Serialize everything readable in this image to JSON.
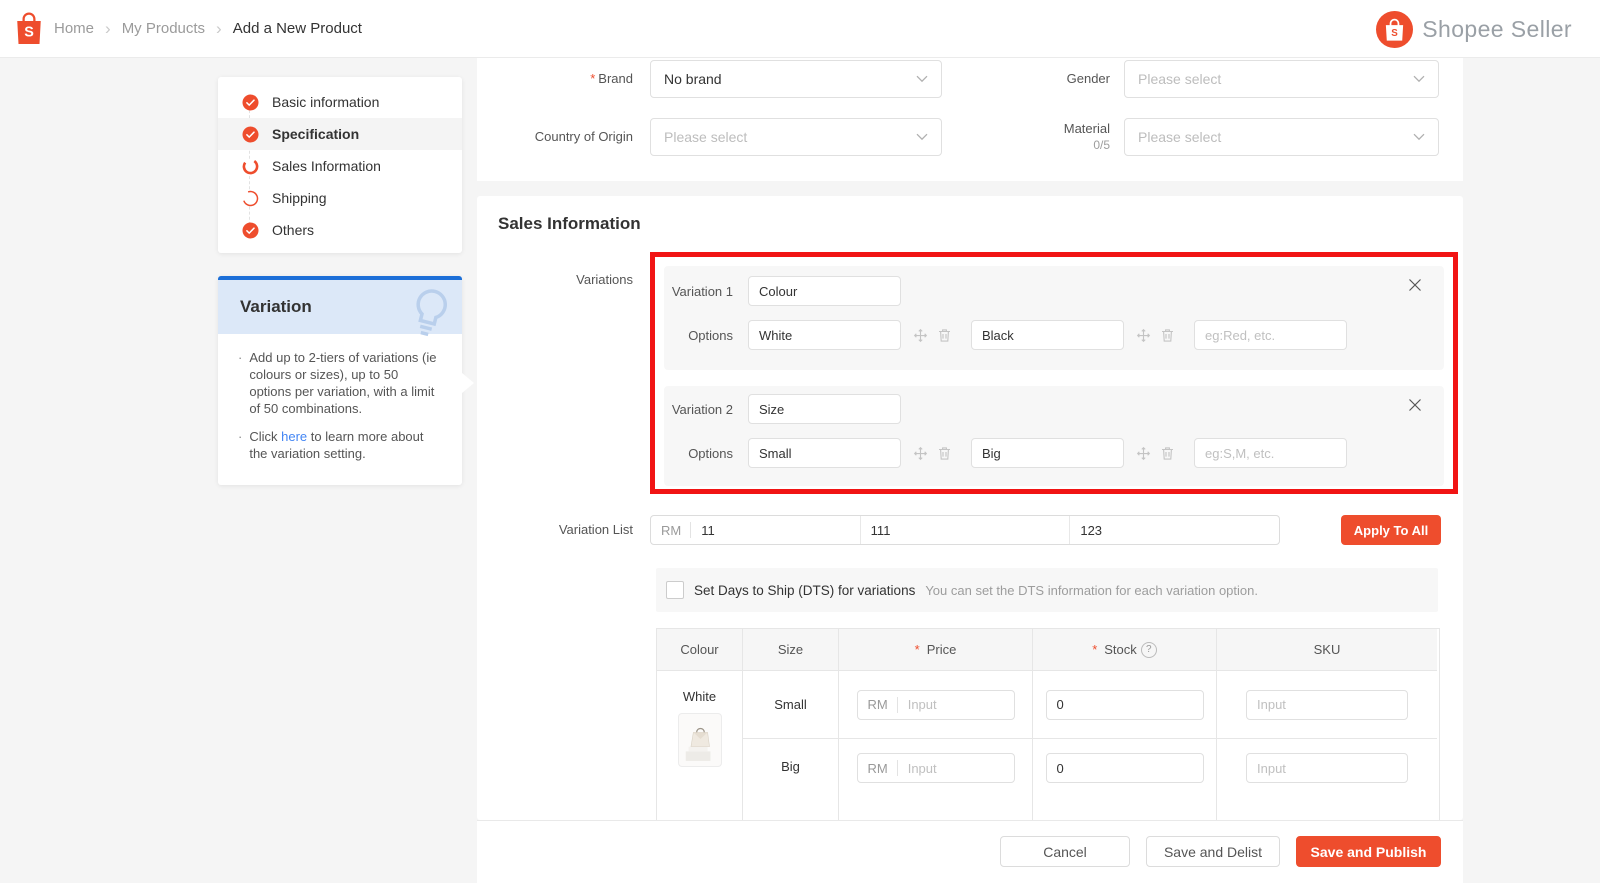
{
  "misc": {
    "required_mark": "*",
    "bullet": "·",
    "separator": "›"
  },
  "colors": {
    "accent_orange": "#ee4d2d",
    "annotation_red": "#f11414",
    "tip_blue": "#1c6fd8",
    "link_blue": "#4285f4"
  },
  "header": {
    "breadcrumb": [
      "Home",
      "My Products",
      "Add a New Product"
    ],
    "brand_name": "Shopee Seller"
  },
  "stepper": {
    "items": [
      {
        "label": "Basic information",
        "state": "done"
      },
      {
        "label": "Specification",
        "state": "done-active"
      },
      {
        "label": "Sales Information",
        "state": "in-progress"
      },
      {
        "label": "Shipping",
        "state": "in-progress"
      },
      {
        "label": "Others",
        "state": "done"
      }
    ]
  },
  "tip": {
    "title": "Variation",
    "bullet1": "Add up to 2-tiers of variations (ie colours or sizes), up to 50 options per variation, with a limit of 50 combinations.",
    "bullet2_prefix": "Click ",
    "bullet2_link": "here",
    "bullet2_suffix": " to learn more about the variation setting."
  },
  "specification_form": {
    "brand": {
      "label": "Brand",
      "value": "No brand",
      "required": true
    },
    "gender": {
      "label": "Gender",
      "placeholder": "Please select"
    },
    "country_of_origin": {
      "label": "Country of Origin",
      "placeholder": "Please select"
    },
    "material": {
      "label": "Material",
      "counter": "0/5",
      "placeholder": "Please select"
    }
  },
  "sales_information": {
    "section_title": "Sales Information",
    "variations_label": "Variations",
    "options_label": "Options",
    "variations": [
      {
        "row_label": "Variation 1",
        "name_value": "Colour",
        "options": [
          "White",
          "Black"
        ],
        "add_placeholder": "eg:Red, etc."
      },
      {
        "row_label": "Variation 2",
        "name_value": "Size",
        "options": [
          "Small",
          "Big"
        ],
        "add_placeholder": "eg:S,M, etc."
      }
    ],
    "variation_list": {
      "label": "Variation List",
      "currency_prefix": "RM",
      "price_value": "11",
      "stock_value": "111",
      "sku_value": "123",
      "apply_button": "Apply To All"
    },
    "dts": {
      "checkbox_label": "Set Days to Ship (DTS) for variations",
      "hint": "You can set the DTS information for each variation option."
    },
    "variation_table": {
      "headers": {
        "colour": "Colour",
        "size": "Size",
        "price": "Price",
        "stock": "Stock",
        "sku": "SKU"
      },
      "colour_value": "White",
      "currency_prefix": "RM",
      "price_placeholder": "Input",
      "sku_placeholder": "Input",
      "rows": [
        {
          "size": "Small",
          "stock_value": "0"
        },
        {
          "size": "Big",
          "stock_value": "0"
        }
      ]
    }
  },
  "footer": {
    "cancel_button": "Cancel",
    "save_delist_button": "Save and Delist",
    "save_publish_button": "Save and Publish"
  }
}
